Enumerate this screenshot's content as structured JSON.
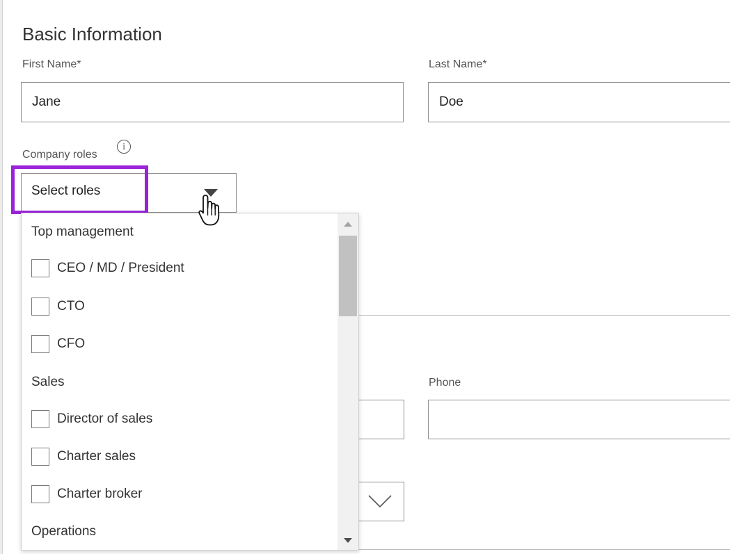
{
  "section": {
    "title": "Basic Information"
  },
  "first_name": {
    "label": "First Name*",
    "value": "Jane"
  },
  "last_name": {
    "label": "Last Name*",
    "value": "Doe"
  },
  "company_roles": {
    "label": "Company roles",
    "info_icon": "info-icon",
    "placeholder": "Select roles",
    "highlight_color": "#9a22d8",
    "groups": [
      {
        "name": "Top management",
        "options": [
          "CEO / MD / President",
          "CTO",
          "CFO"
        ]
      },
      {
        "name": "Sales",
        "options": [
          "Director of sales",
          "Charter sales",
          "Charter broker"
        ]
      },
      {
        "name": "Operations",
        "options": []
      }
    ]
  },
  "phone": {
    "label": "Phone",
    "value": ""
  },
  "icons": {
    "caret": "caret-down-icon",
    "chevron": "chevron-down-icon",
    "cursor": "hand-pointer-icon"
  }
}
